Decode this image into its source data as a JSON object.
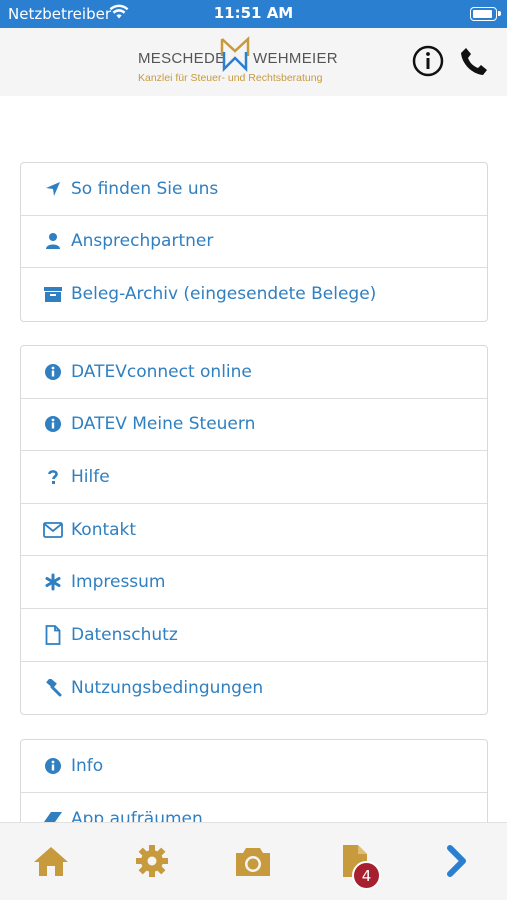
{
  "status_bar": {
    "carrier": "Netzbetreiber",
    "time": "11:51 AM",
    "battery_level": 0.9
  },
  "header": {
    "logo": {
      "left_text": "MESCHEDE",
      "right_text": "WEHMEIER",
      "subtitle": "Kanzlei für Steuer- und Rechtsberatung"
    },
    "info_icon": "info-circle-icon",
    "phone_icon": "phone-icon"
  },
  "menu": {
    "group1": [
      {
        "label": "So finden Sie uns",
        "icon": "location-arrow-icon"
      },
      {
        "label": "Ansprechpartner",
        "icon": "user-icon"
      },
      {
        "label": "Beleg-Archiv (eingesendete Belege)",
        "icon": "archive-icon"
      }
    ],
    "group2": [
      {
        "label": "DATEVconnect online",
        "icon": "info-circle-icon"
      },
      {
        "label": "DATEV Meine Steuern",
        "icon": "info-circle-icon"
      },
      {
        "label": "Hilfe",
        "icon": "question-icon"
      },
      {
        "label": "Kontakt",
        "icon": "envelope-icon"
      },
      {
        "label": "Impressum",
        "icon": "asterisk-icon"
      },
      {
        "label": "Datenschutz",
        "icon": "file-icon"
      },
      {
        "label": "Nutzungsbedingungen",
        "icon": "gavel-icon"
      }
    ],
    "group3": [
      {
        "label": "Info",
        "icon": "info-circle-icon"
      },
      {
        "label": "App aufräumen",
        "icon": "eraser-icon"
      }
    ]
  },
  "tab_bar": {
    "items": [
      "home-icon",
      "settings-gear-icon",
      "camera-icon",
      "documents-icon",
      "chevron-right-icon"
    ],
    "documents_badge": "4"
  },
  "colors": {
    "status_bar": "#2b7fd0",
    "link_blue": "#2f7fc1",
    "gold": "#c79a3d",
    "badge_red": "#a6202f"
  }
}
